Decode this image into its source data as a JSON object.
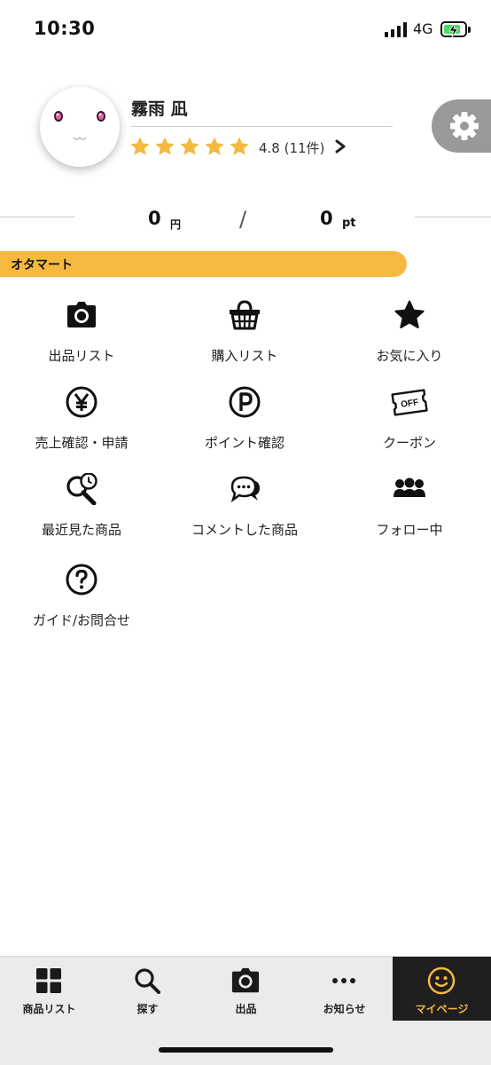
{
  "status_bar": {
    "time": "10:30",
    "network": "4G",
    "battery_icon": "battery-charging-icon"
  },
  "profile": {
    "name": "霧雨 凪",
    "rating_value": 4.8,
    "stars_filled": 5,
    "rating_text": "4.8 (11件)",
    "settings_icon": "gear-icon",
    "star_color": "#f5b940"
  },
  "balance": {
    "yen_value": "0",
    "yen_unit": "円",
    "separator": "/",
    "points_value": "0",
    "points_unit": "pt"
  },
  "section": {
    "title": "オタマート",
    "accent_color": "#f5b940"
  },
  "menu": {
    "items": [
      {
        "label": "出品リスト",
        "icon": "camera-icon"
      },
      {
        "label": "購入リスト",
        "icon": "basket-icon"
      },
      {
        "label": "お気に入り",
        "icon": "star-icon"
      },
      {
        "label": "売上確認・申請",
        "icon": "yen-icon"
      },
      {
        "label": "ポイント確認",
        "icon": "point-icon"
      },
      {
        "label": "クーポン",
        "icon": "coupon-off-icon"
      },
      {
        "label": "最近見た商品",
        "icon": "recent-search-icon"
      },
      {
        "label": "コメントした商品",
        "icon": "comment-icon"
      },
      {
        "label": "フォロー中",
        "icon": "people-icon"
      },
      {
        "label": "ガイド/お問合せ",
        "icon": "question-icon"
      }
    ],
    "coupon_badge": "OFF"
  },
  "bottom_nav": {
    "items": [
      {
        "label": "商品リスト",
        "icon": "grid-icon"
      },
      {
        "label": "探す",
        "icon": "search-icon"
      },
      {
        "label": "出品",
        "icon": "camera-icon"
      },
      {
        "label": "お知らせ",
        "icon": "more-dots-icon"
      },
      {
        "label": "マイページ",
        "icon": "smiley-icon",
        "active": true
      }
    ],
    "active_color": "#f5b940"
  }
}
